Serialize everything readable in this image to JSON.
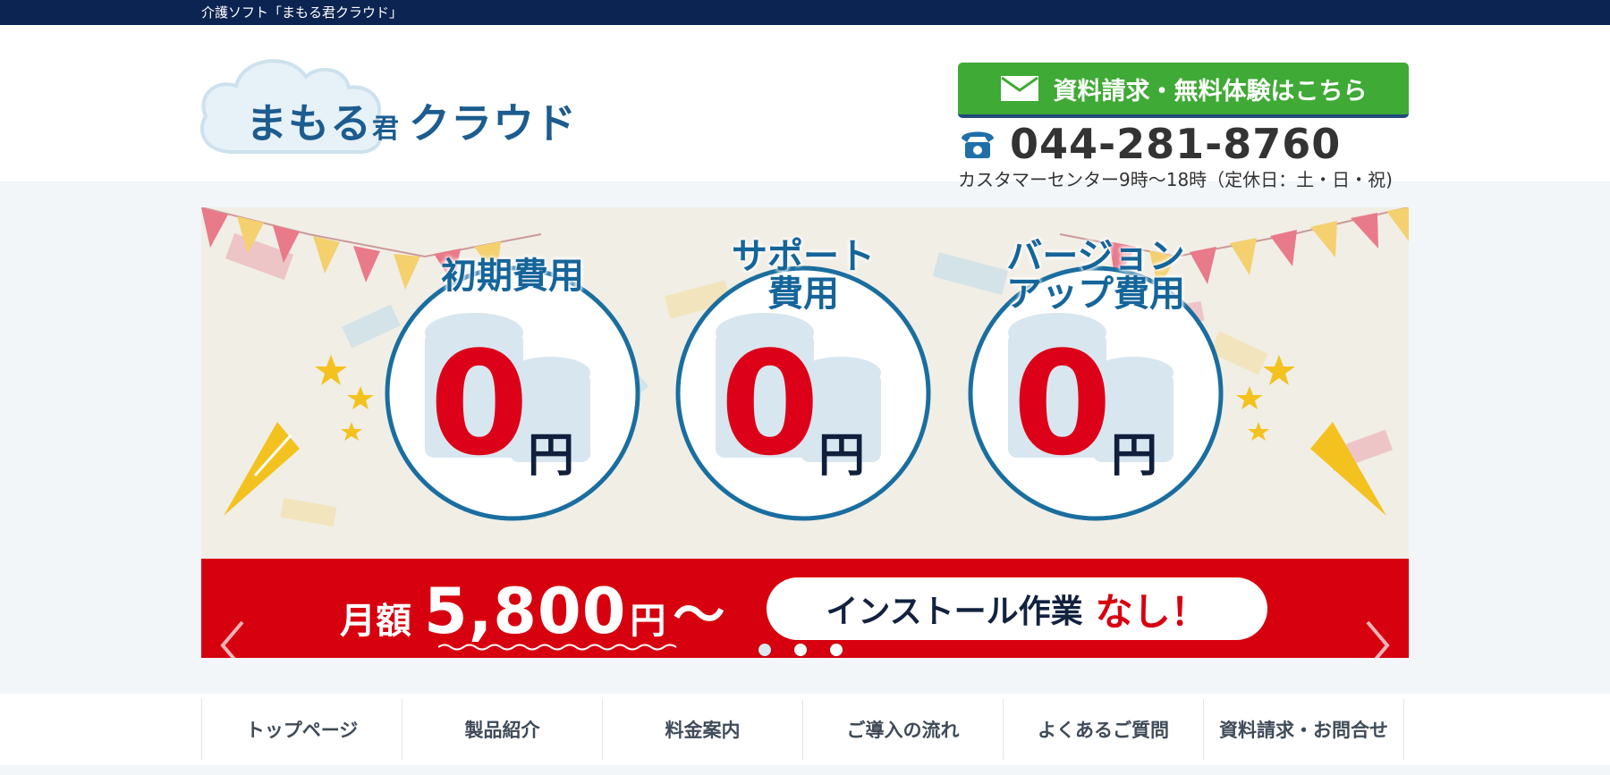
{
  "topbar": {
    "text": "介護ソフト「まもる君クラウド」"
  },
  "logo": {
    "main": "まもる",
    "kun": "君",
    "cloud": "クラウド"
  },
  "header": {
    "cta_label": "資料請求・無料体験はこちら",
    "phone": "044-281-8760",
    "hours": "カスタマーセンター9時〜18時（定休日：土・日・祝)"
  },
  "slider": {
    "coins": [
      {
        "line1": "初期費用",
        "line2": "",
        "zero": "0",
        "yen": "円"
      },
      {
        "line1": "サポート",
        "line2": "費用",
        "zero": "0",
        "yen": "円"
      },
      {
        "line1": "バージョン",
        "line2": "アップ費用",
        "zero": "0",
        "yen": "円"
      }
    ],
    "banner": {
      "monthly_label": "月額",
      "price": "5,800",
      "price_yen": "円",
      "tilde": "〜",
      "install_text": "インストール作業",
      "install_none": "なし！"
    },
    "dots": 3,
    "active_dot": 0
  },
  "nav": {
    "items": [
      {
        "label": "トップページ"
      },
      {
        "label": "製品紹介"
      },
      {
        "label": "料金案内"
      },
      {
        "label": "ご導入の流れ"
      },
      {
        "label": "よくあるご質問"
      },
      {
        "label": "資料請求・お問合せ"
      }
    ]
  },
  "colors": {
    "topbar": "#0c2451",
    "cta_green": "#3faa35",
    "banner_red": "#d7000f",
    "zero_red": "#dd0019",
    "coin_blue": "#15659a",
    "logo_blue": "#1c5c8f"
  }
}
